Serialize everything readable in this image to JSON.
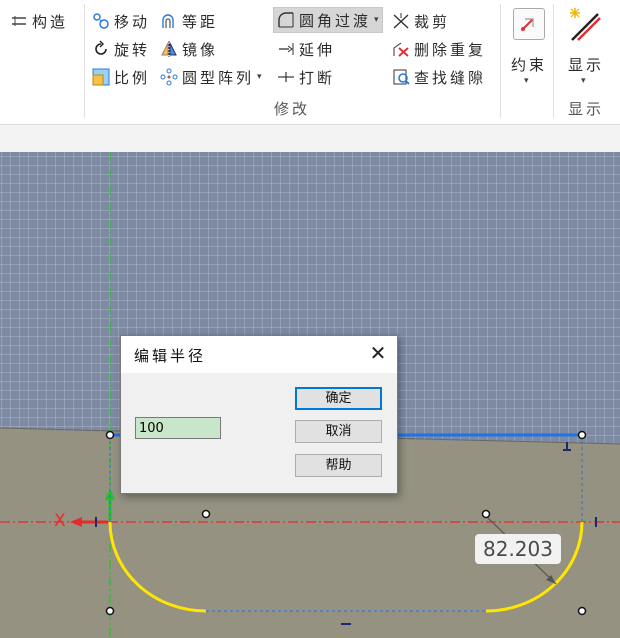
{
  "ribbon": {
    "construct": "构造",
    "move": "移动",
    "offset": "等距",
    "rotate": "旋转",
    "mirror": "镜像",
    "scale": "比例",
    "pattern": "圆型阵列",
    "fillet": "圆角过渡",
    "extend": "延伸",
    "break": "打断",
    "trim": "裁剪",
    "delete_dup": "删除重复",
    "find_gap": "查找缝隙",
    "modify_label": "修改",
    "constraint": "约束",
    "display": "显示",
    "display_label": "显示"
  },
  "dialog": {
    "title": "编辑半径",
    "close": "✕",
    "value": "100",
    "ok": "确定",
    "cancel": "取消",
    "help": "帮助"
  },
  "canvas": {
    "dimension_value": "82.203",
    "axis_label": "X"
  },
  "colors": {
    "grid_bg": "#7e8aa2",
    "grid_line": "#a7b3c9",
    "ground": "#959282",
    "arc": "#ffe600",
    "line_blue": "#1e73e8",
    "axis_red": "#e52b2b",
    "axis_green": "#22c02a"
  }
}
